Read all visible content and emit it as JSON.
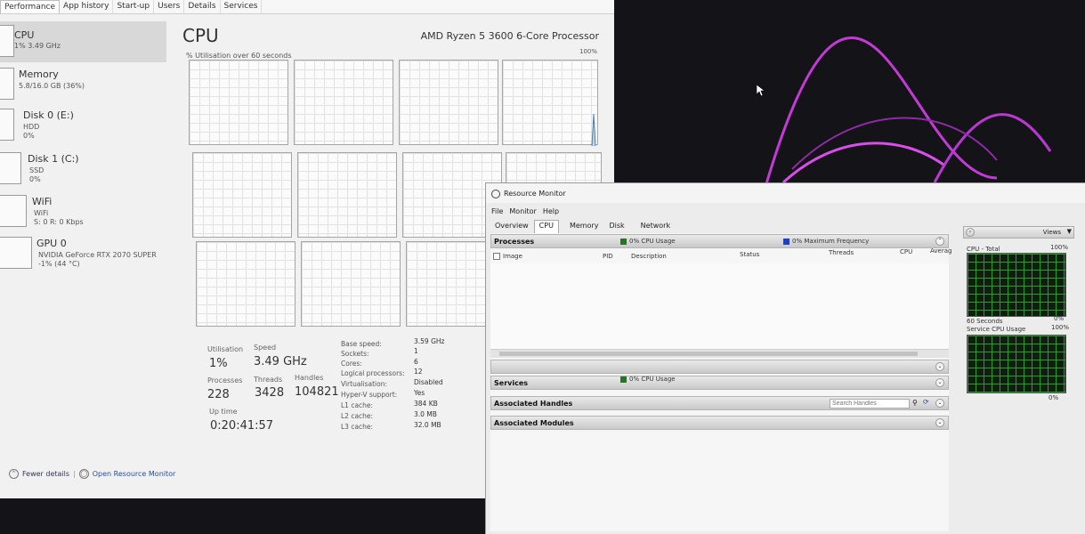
{
  "task_manager": {
    "tabs": [
      "Performance",
      "App history",
      "Start-up",
      "Users",
      "Details",
      "Services"
    ],
    "active_tab": "Performance",
    "sidebar": [
      {
        "title": "CPU",
        "sub": "1% 3.49 GHz",
        "sub2": ""
      },
      {
        "title": "Memory",
        "sub": "5.8/16.0 GB (36%)",
        "sub2": ""
      },
      {
        "title": "Disk 0 (E:)",
        "sub": "HDD",
        "sub2": "0%"
      },
      {
        "title": "Disk 1 (C:)",
        "sub": "SSD",
        "sub2": "0%"
      },
      {
        "title": "WiFi",
        "sub": "WiFi",
        "sub2": "S: 0 R: 0 Kbps"
      },
      {
        "title": "GPU 0",
        "sub": "NVIDIA GeForce RTX 2070 SUPER",
        "sub2": "-1% (44 °C)"
      }
    ],
    "main": {
      "heading": "CPU",
      "model": "AMD Ryzen 5 3600 6-Core Processor",
      "util_label": "% Utilisation over 60 seconds",
      "util_max": "100%"
    },
    "stats": {
      "utilisation_label": "Utilisation",
      "utilisation": "1%",
      "speed_label": "Speed",
      "speed": "3.49 GHz",
      "processes_label": "Processes",
      "processes": "228",
      "threads_label": "Threads",
      "threads": "3428",
      "handles_label": "Handles",
      "handles": "104821",
      "uptime_label": "Up time",
      "uptime": "0:20:41:57"
    },
    "details": [
      {
        "label": "Base speed:",
        "value": "3.59 GHz"
      },
      {
        "label": "Sockets:",
        "value": "1"
      },
      {
        "label": "Cores:",
        "value": "6"
      },
      {
        "label": "Logical processors:",
        "value": "12"
      },
      {
        "label": "Virtualisation:",
        "value": "Disabled"
      },
      {
        "label": "Hyper-V support:",
        "value": "Yes"
      },
      {
        "label": "L1 cache:",
        "value": "384 KB"
      },
      {
        "label": "L2 cache:",
        "value": "3.0 MB"
      },
      {
        "label": "L3 cache:",
        "value": "32.0 MB"
      }
    ],
    "footer": {
      "fewer_details": "Fewer details",
      "open_rm": "Open Resource Monitor"
    }
  },
  "resource_monitor": {
    "title": "Resource Monitor",
    "menu": [
      "File",
      "Monitor",
      "Help"
    ],
    "tabs": [
      "Overview",
      "CPU",
      "Memory",
      "Disk",
      "Network"
    ],
    "active_tab": "CPU",
    "processes": {
      "title": "Processes",
      "cpu_usage": "0% CPU Usage",
      "max_freq": "0% Maximum Frequency",
      "columns": [
        "Image",
        "PID",
        "Description",
        "Status",
        "Threads",
        "CPU",
        "Averag"
      ]
    },
    "services": {
      "title": "Services",
      "cpu_usage": "0% CPU Usage"
    },
    "handles": {
      "title": "Associated Handles",
      "search_placeholder": "Search Handles"
    },
    "modules": {
      "title": "Associated Modules"
    },
    "right": {
      "views": "Views",
      "cpu_total_label": "CPU - Total",
      "cpu_total_max": "100%",
      "seconds_label": "60 Seconds",
      "seconds_pct": "0%",
      "service_cpu_label": "Service CPU Usage",
      "service_cpu_max": "100%",
      "service_cpu_pct": "0%"
    },
    "colors": {
      "cpu_usage": "#1f7a1f",
      "max_freq": "#1f3fbf"
    }
  }
}
